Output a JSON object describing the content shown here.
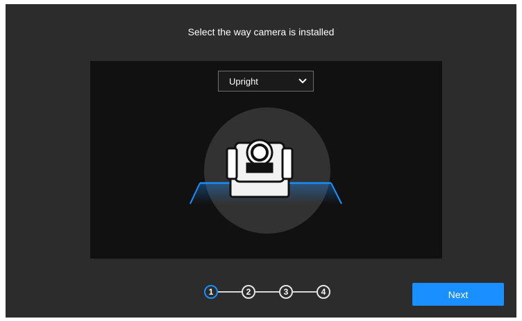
{
  "dialog": {
    "title": "Select the way camera is installed"
  },
  "install_mode": {
    "selected": "Upright",
    "icon": "chevron-down-icon"
  },
  "illustration": {
    "icon": "ptz-camera-icon",
    "accent_color": "#1a8fff"
  },
  "steps": {
    "items": [
      "1",
      "2",
      "3",
      "4"
    ],
    "current": "1"
  },
  "footer": {
    "next_label": "Next"
  },
  "colors": {
    "background": "#2c2c2c",
    "preview_background": "#111111",
    "accent": "#1a8fff",
    "text": "#ffffff"
  }
}
